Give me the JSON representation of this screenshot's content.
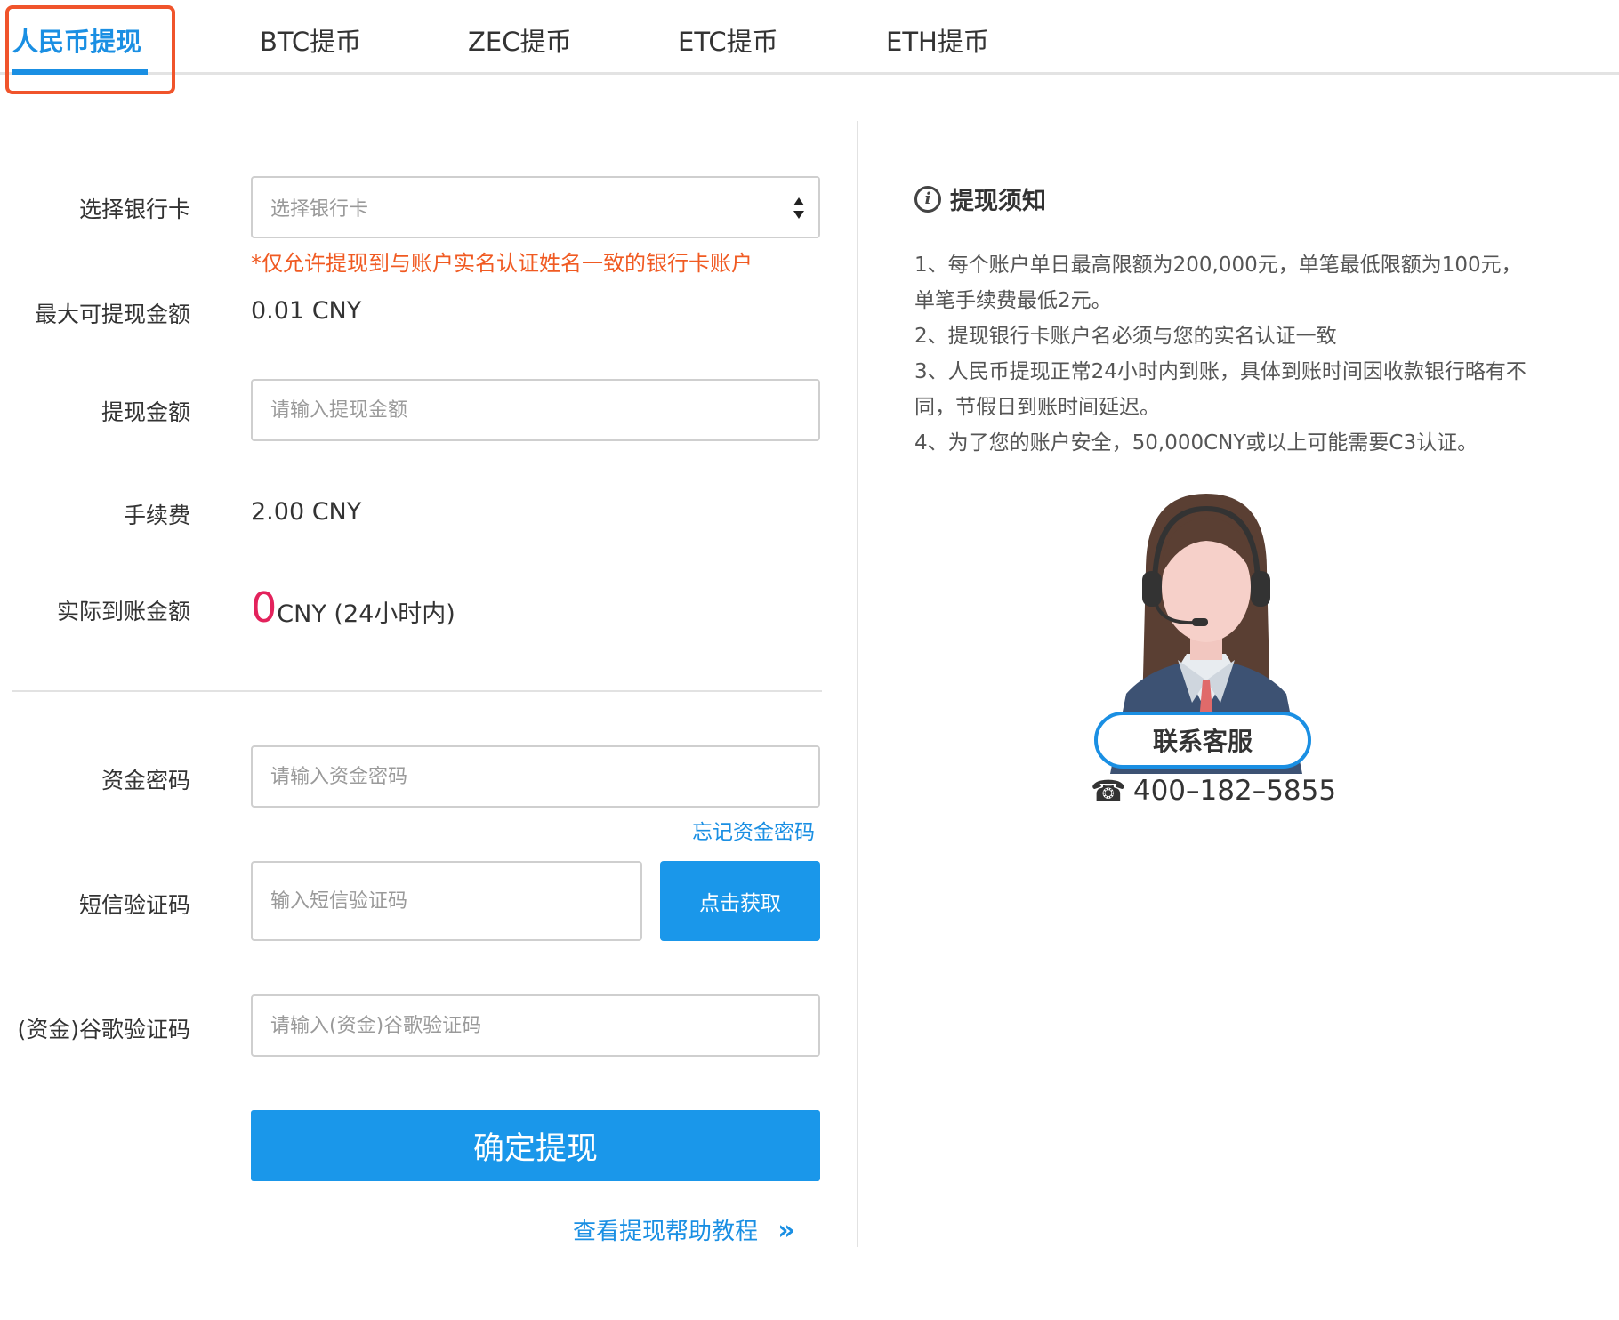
{
  "tabs": [
    {
      "label": "人民币提现",
      "active": true
    },
    {
      "label": "BTC提币",
      "active": false
    },
    {
      "label": "ZEC提币",
      "active": false
    },
    {
      "label": "ETC提币",
      "active": false
    },
    {
      "label": "ETH提币",
      "active": false
    }
  ],
  "form": {
    "bank_card": {
      "label": "选择银行卡",
      "placeholder": "选择银行卡"
    },
    "warning": "*仅允许提现到与账户实名认证姓名一致的银行卡账户",
    "max_amount": {
      "label": "最大可提现金额",
      "value": "0.01 CNY"
    },
    "amount": {
      "label": "提现金额",
      "placeholder": "请输入提现金额"
    },
    "fee": {
      "label": "手续费",
      "value": "2.00 CNY"
    },
    "actual": {
      "label": "实际到账金额",
      "value": "0",
      "suffix": "CNY (24小时内)"
    },
    "fund_password": {
      "label": "资金密码",
      "placeholder": "请输入资金密码",
      "forgot_link": "忘记资金密码"
    },
    "sms": {
      "label": "短信验证码",
      "placeholder": "输入短信验证码",
      "button": "点击获取"
    },
    "google": {
      "label": "(资金)谷歌验证码",
      "placeholder": "请输入(资金)谷歌验证码"
    },
    "submit": "确定提现",
    "help_link": "查看提现帮助教程",
    "help_arrow": "»"
  },
  "notice": {
    "icon": "info-icon",
    "title": "提现须知",
    "items": [
      "1、每个账户单日最高限额为200,000元，单笔最低限额为100元， 单笔手续费最低2元。",
      "2、提现银行卡账户名必须与您的实名认证一致",
      "3、人民币提现正常24小时内到账，具体到账时间因收款银行略有不同，节假日到账时间延迟。",
      "4、为了您的账户安全，50,000CNY或以上可能需要C3认证。"
    ]
  },
  "support": {
    "button": "联系客服",
    "phone_icon": "☎",
    "phone": "400–182–5855"
  },
  "colors": {
    "accent": "#1a8fe3",
    "button": "#1a97ea",
    "warning": "#f05a22",
    "amount_zero": "#e3225c",
    "highlight": "#f0542b"
  }
}
